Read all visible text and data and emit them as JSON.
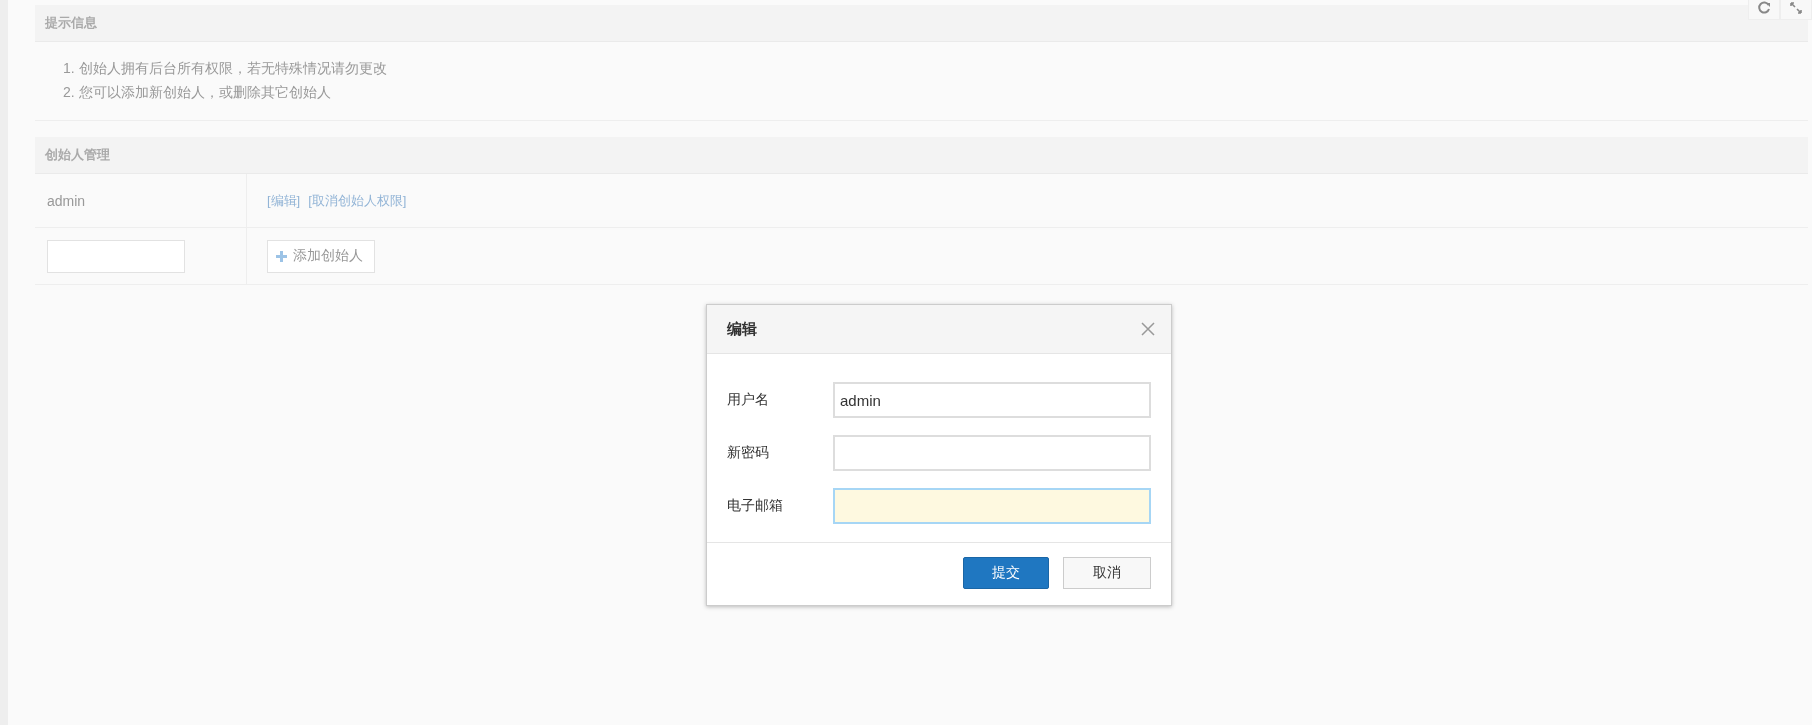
{
  "tips_panel": {
    "title": "提示信息",
    "items": [
      "1. 创始人拥有后台所有权限，若无特殊情况请勿更改",
      "2. 您可以添加新创始人，或删除其它创始人"
    ]
  },
  "founders_panel": {
    "title": "创始人管理",
    "rows": [
      {
        "name": "admin",
        "links": [
          "[编辑]",
          "[取消创始人权限]"
        ]
      }
    ],
    "add_button": "添加创始人"
  },
  "dialog": {
    "title": "编辑",
    "fields": [
      {
        "label": "用户名",
        "value": "admin",
        "focused": false
      },
      {
        "label": "新密码",
        "focused": false
      },
      {
        "label": "电子邮箱",
        "focused": true
      }
    ],
    "buttons": [
      {
        "label": "提交",
        "kind": "primary"
      },
      {
        "label": "取消",
        "kind": "default"
      }
    ]
  }
}
